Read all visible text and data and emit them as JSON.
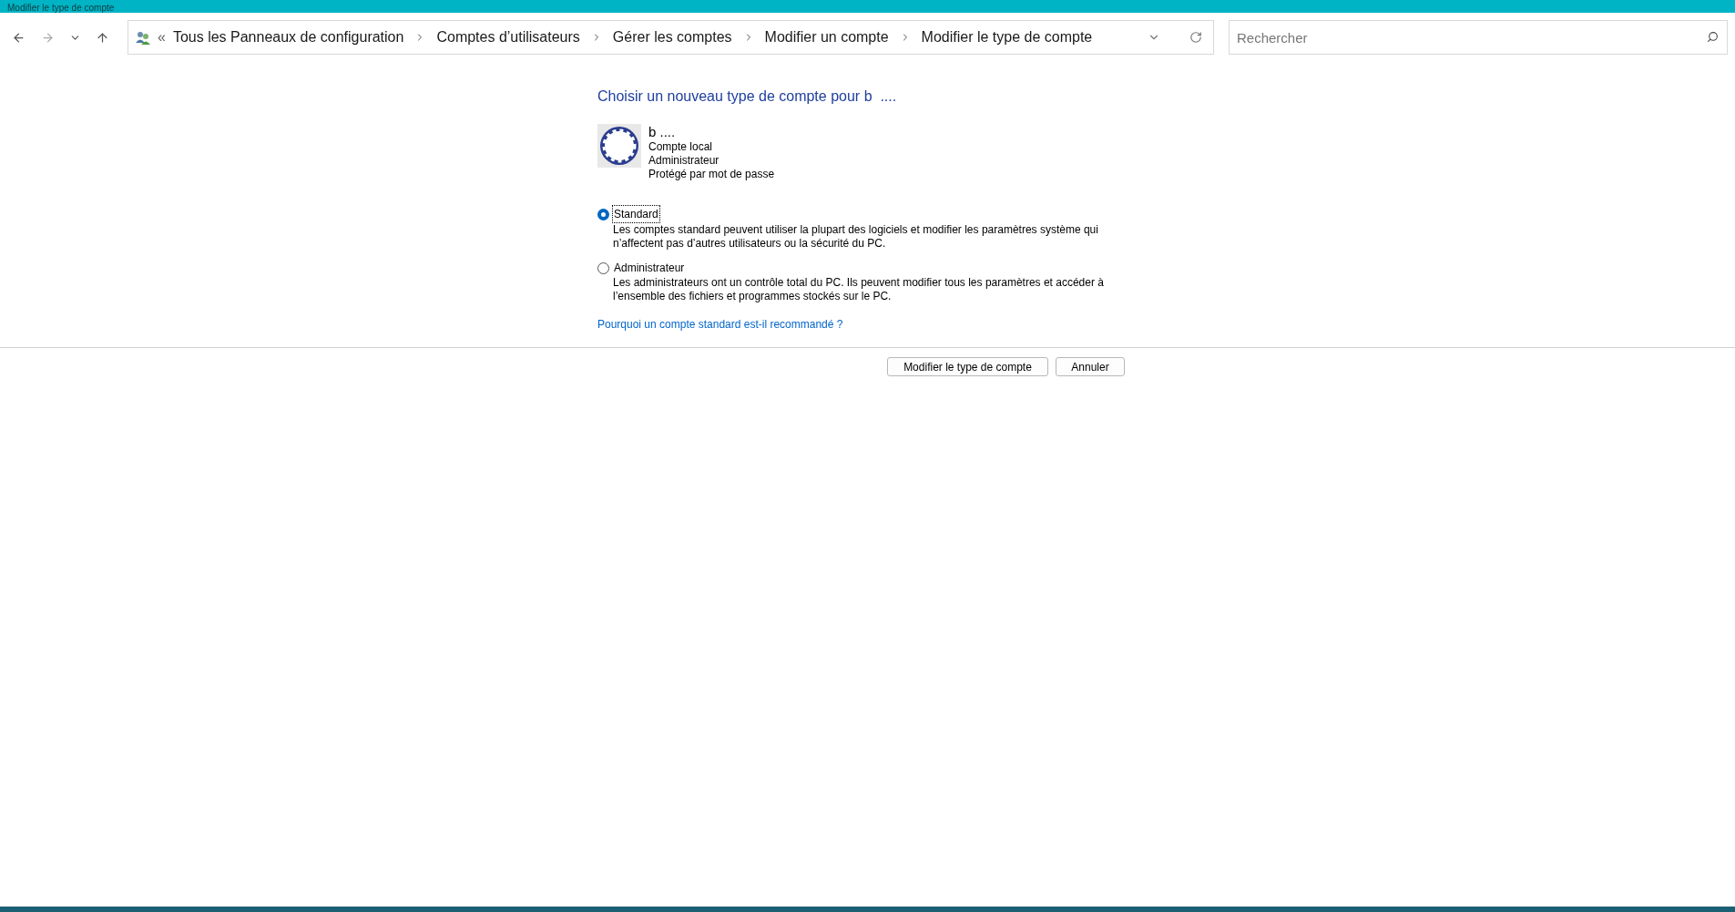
{
  "window": {
    "title": "Modifier le type de compte"
  },
  "address_bar": {
    "overflow": "«",
    "breadcrumbs": [
      "Tous les Panneaux de configuration",
      "Comptes d’utilisateurs",
      "Gérer les comptes",
      "Modifier un compte",
      "Modifier le type de compte"
    ]
  },
  "search": {
    "placeholder": "Rechercher"
  },
  "heading": "Choisir un nouveau type de compte pour b  ....",
  "account": {
    "name": "b ....",
    "details": [
      "Compte local",
      "Administrateur",
      "Protégé par mot de passe"
    ]
  },
  "options": [
    {
      "label": "Standard",
      "description": "Les comptes standard peuvent utiliser la plupart des logiciels et modifier les paramètres système qui n’affectent pas d’autres utilisateurs ou la sécurité du PC.",
      "selected": true
    },
    {
      "label": "Administrateur",
      "description": "Les administrateurs ont un contrôle total du PC. Ils peuvent modifier tous les paramètres et accéder à l’ensemble des fichiers et programmes stockés sur le PC.",
      "selected": false
    }
  ],
  "help_link": "Pourquoi un compte standard est-il recommandé ?",
  "buttons": [
    "Modifier le type de compte",
    "Annuler"
  ]
}
